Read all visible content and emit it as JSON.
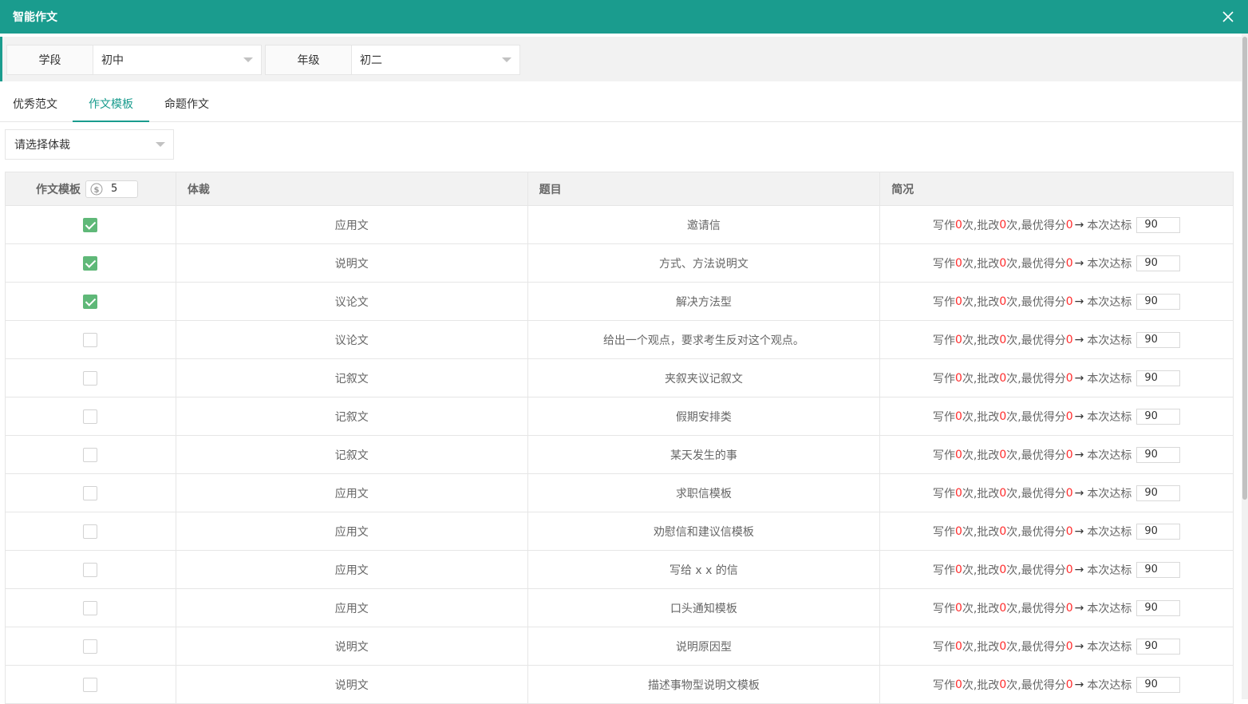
{
  "window": {
    "title": "智能作文"
  },
  "filters": {
    "stage": {
      "label": "学段",
      "value": "初中"
    },
    "grade": {
      "label": "年级",
      "value": "初二"
    }
  },
  "tabs": [
    {
      "label": "优秀范文",
      "active": false
    },
    {
      "label": "作文模板",
      "active": true
    },
    {
      "label": "命题作文",
      "active": false
    }
  ],
  "genre_select": {
    "placeholder": "请选择体裁"
  },
  "table": {
    "headers": [
      "作文模板",
      "体裁",
      "题目",
      "简况"
    ],
    "coin_value": "5",
    "brief": {
      "write_label": "写作",
      "times": "次,批改",
      "times2": "次,最优得分",
      "arrow": "→",
      "target_label": "本次达标"
    },
    "rows": [
      {
        "checked": true,
        "genre": "应用文",
        "topic": "邀请信",
        "writes": "0",
        "revisions": "0",
        "best": "0",
        "target": "90"
      },
      {
        "checked": true,
        "genre": "说明文",
        "topic": "方式、方法说明文",
        "writes": "0",
        "revisions": "0",
        "best": "0",
        "target": "90"
      },
      {
        "checked": true,
        "genre": "议论文",
        "topic": "解决方法型",
        "writes": "0",
        "revisions": "0",
        "best": "0",
        "target": "90"
      },
      {
        "checked": false,
        "genre": "议论文",
        "topic": "给出一个观点，要求考生反对这个观点。",
        "writes": "0",
        "revisions": "0",
        "best": "0",
        "target": "90"
      },
      {
        "checked": false,
        "genre": "记叙文",
        "topic": "夹叙夹议记叙文",
        "writes": "0",
        "revisions": "0",
        "best": "0",
        "target": "90"
      },
      {
        "checked": false,
        "genre": "记叙文",
        "topic": "假期安排类",
        "writes": "0",
        "revisions": "0",
        "best": "0",
        "target": "90"
      },
      {
        "checked": false,
        "genre": "记叙文",
        "topic": "某天发生的事",
        "writes": "0",
        "revisions": "0",
        "best": "0",
        "target": "90"
      },
      {
        "checked": false,
        "genre": "应用文",
        "topic": "求职信模板",
        "writes": "0",
        "revisions": "0",
        "best": "0",
        "target": "90"
      },
      {
        "checked": false,
        "genre": "应用文",
        "topic": "劝慰信和建议信模板",
        "writes": "0",
        "revisions": "0",
        "best": "0",
        "target": "90"
      },
      {
        "checked": false,
        "genre": "应用文",
        "topic": "写给 x x 的信",
        "writes": "0",
        "revisions": "0",
        "best": "0",
        "target": "90"
      },
      {
        "checked": false,
        "genre": "应用文",
        "topic": "口头通知模板",
        "writes": "0",
        "revisions": "0",
        "best": "0",
        "target": "90"
      },
      {
        "checked": false,
        "genre": "说明文",
        "topic": "说明原因型",
        "writes": "0",
        "revisions": "0",
        "best": "0",
        "target": "90"
      },
      {
        "checked": false,
        "genre": "说明文",
        "topic": "描述事物型说明文模板",
        "writes": "0",
        "revisions": "0",
        "best": "0",
        "target": "90"
      }
    ]
  },
  "icons": {
    "close": "close-icon",
    "coin": "coin-icon",
    "dropdown": "chevron-down-icon"
  },
  "colors": {
    "accent": "#1a9c8e",
    "checkbox_on": "#5fb878",
    "highlight": "#ff2b2b"
  }
}
